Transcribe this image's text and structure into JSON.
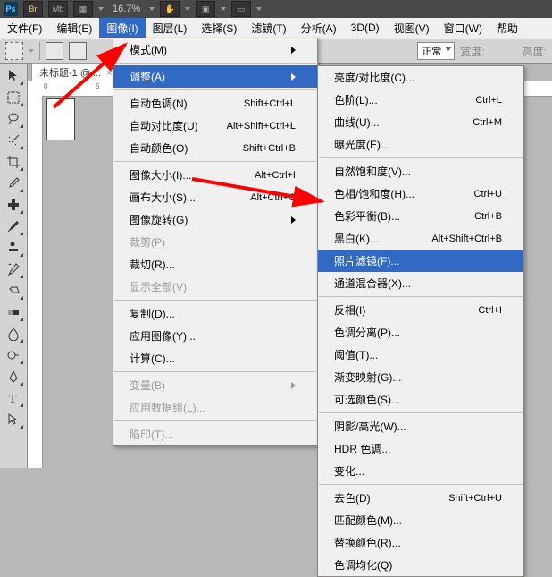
{
  "top": {
    "zoom": "16.7%"
  },
  "menubar": {
    "items": [
      "文件(F)",
      "编辑(E)",
      "图像(I)",
      "图层(L)",
      "选择(S)",
      "滤镜(T)",
      "分析(A)",
      "3D(D)",
      "视图(V)",
      "窗口(W)",
      "帮助"
    ]
  },
  "optbar": {
    "mode_label": "正常",
    "width_label": "宽度:",
    "height_label": "高度:"
  },
  "doc": {
    "tab": "未标题-1 @ ..."
  },
  "menu1": {
    "mode": "模式(M)",
    "adjust": "调整(A)",
    "auto_tone": "自动色调(N)",
    "auto_tone_sc": "Shift+Ctrl+L",
    "auto_contrast": "自动对比度(U)",
    "auto_contrast_sc": "Alt+Shift+Ctrl+L",
    "auto_color": "自动颜色(O)",
    "auto_color_sc": "Shift+Ctrl+B",
    "img_size": "图像大小(I)...",
    "img_size_sc": "Alt+Ctrl+I",
    "canvas_size": "画布大小(S)...",
    "canvas_size_sc": "Alt+Ctrl+C",
    "img_rotate": "图像旋转(G)",
    "crop": "裁剪(P)",
    "trim": "裁切(R)...",
    "reveal": "显示全部(V)",
    "duplicate": "复制(D)...",
    "apply": "应用图像(Y)...",
    "calc": "计算(C)...",
    "vars": "变量(B)",
    "data_set": "应用数据组(L)...",
    "trap": "陷印(T)..."
  },
  "menu2": {
    "bc": "亮度/对比度(C)...",
    "levels": "色阶(L)...",
    "levels_sc": "Ctrl+L",
    "curves": "曲线(U)...",
    "curves_sc": "Ctrl+M",
    "exposure": "曝光度(E)...",
    "vibrance": "自然饱和度(V)...",
    "hue": "色相/饱和度(H)...",
    "hue_sc": "Ctrl+U",
    "cb": "色彩平衡(B)...",
    "cb_sc": "Ctrl+B",
    "bw": "黑白(K)...",
    "bw_sc": "Alt+Shift+Ctrl+B",
    "pf": "照片滤镜(F)...",
    "cm": "通道混合器(X)...",
    "invert": "反相(I)",
    "invert_sc": "Ctrl+I",
    "poster": "色调分离(P)...",
    "thresh": "阈值(T)...",
    "gm": "渐变映射(G)...",
    "sc": "可选颜色(S)...",
    "sh": "阴影/高光(W)...",
    "hdr": "HDR 色调...",
    "var": "变化...",
    "desat": "去色(D)",
    "desat_sc": "Shift+Ctrl+U",
    "match": "匹配颜色(M)...",
    "replace": "替换颜色(R)...",
    "equal": "色调均化(Q)"
  }
}
